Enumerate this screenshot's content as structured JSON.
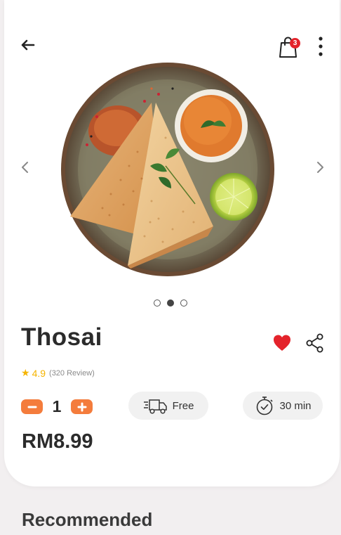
{
  "header": {
    "cart_count": "3",
    "icons": {
      "back": "arrow-left-icon",
      "cart": "shopping-bag-icon",
      "more": "more-vertical-icon"
    }
  },
  "gallery": {
    "image_alt": "Thosai dish with chutney, sambal powder and lime",
    "slide_count": 3,
    "active_slide_index": 1
  },
  "product": {
    "name": "Thosai",
    "rating": "4.9",
    "review_count": "(320 Review)",
    "quantity": "1",
    "delivery_label": "Free",
    "time_label": "30 min",
    "price": "RM8.99",
    "favorite": true
  },
  "colors": {
    "accent": "#f47c3c",
    "heart": "#e4232b",
    "star": "#f5b400",
    "badge": "#e4232b"
  },
  "sections": {
    "recommended_title": "Recommended"
  }
}
